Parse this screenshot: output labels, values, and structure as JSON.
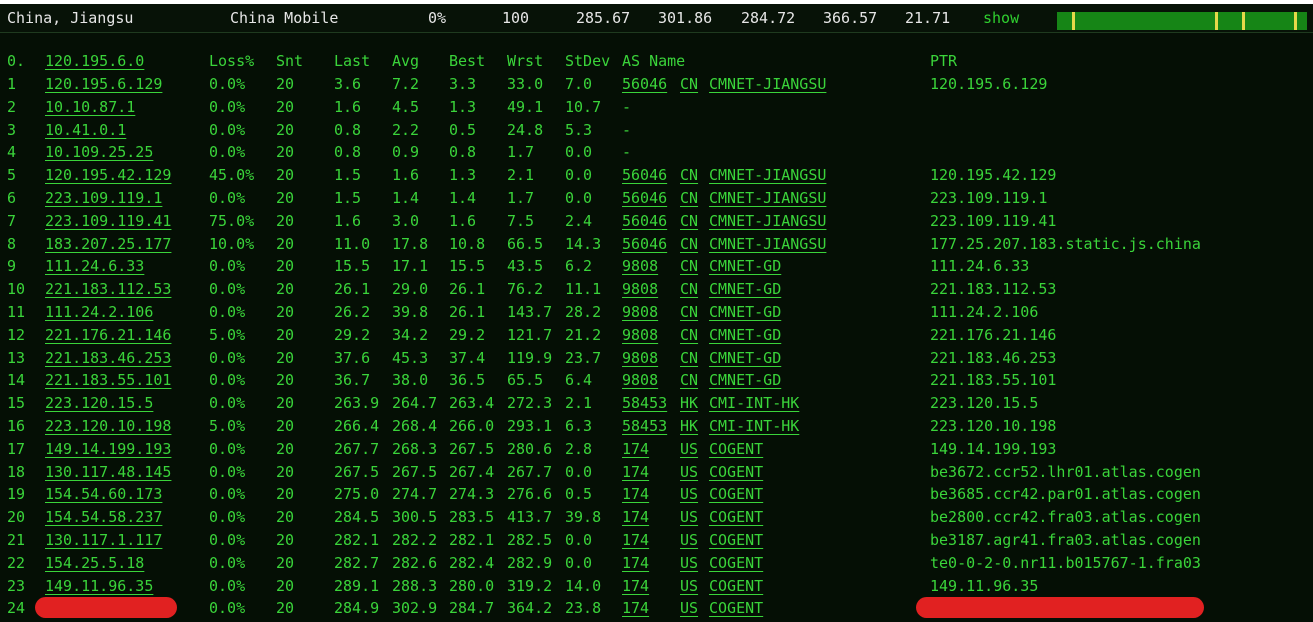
{
  "summary": {
    "location": "China, Jiangsu",
    "isp": "China Mobile",
    "loss": "0%",
    "sent": "100",
    "last": "285.67",
    "avg": "301.86",
    "best": "284.72",
    "worst": "366.57",
    "stdev": "21.71",
    "show_label": "show",
    "sparkline_marks": [
      0.06,
      0.64,
      0.75,
      0.96
    ]
  },
  "table": {
    "headers": {
      "index": "0.",
      "host": "120.195.6.0",
      "loss": "Loss%",
      "snt": "Snt",
      "last": "Last",
      "avg": "Avg",
      "best": "Best",
      "wrst": "Wrst",
      "stdev": "StDev",
      "as_name": "AS Name",
      "ptr": "PTR"
    },
    "rows": [
      {
        "idx": "1",
        "host": "120.195.6.129",
        "loss": "0.0%",
        "snt": "20",
        "last": "3.6",
        "avg": "7.2",
        "best": "3.3",
        "wrst": "33.0",
        "stdev": "7.0",
        "asn": "56046",
        "cc": "CN",
        "asname": "CMNET-JIANGSU",
        "ptr": "120.195.6.129"
      },
      {
        "idx": "2",
        "host": "10.10.87.1",
        "loss": "0.0%",
        "snt": "20",
        "last": "1.6",
        "avg": "4.5",
        "best": "1.3",
        "wrst": "49.1",
        "stdev": "10.7",
        "asn": "-",
        "cc": "",
        "asname": "",
        "ptr": ""
      },
      {
        "idx": "3",
        "host": "10.41.0.1",
        "loss": "0.0%",
        "snt": "20",
        "last": "0.8",
        "avg": "2.2",
        "best": "0.5",
        "wrst": "24.8",
        "stdev": "5.3",
        "asn": "-",
        "cc": "",
        "asname": "",
        "ptr": ""
      },
      {
        "idx": "4",
        "host": "10.109.25.25",
        "loss": "0.0%",
        "snt": "20",
        "last": "0.8",
        "avg": "0.9",
        "best": "0.8",
        "wrst": "1.7",
        "stdev": "0.0",
        "asn": "-",
        "cc": "",
        "asname": "",
        "ptr": ""
      },
      {
        "idx": "5",
        "host": "120.195.42.129",
        "loss": "45.0%",
        "snt": "20",
        "last": "1.5",
        "avg": "1.6",
        "best": "1.3",
        "wrst": "2.1",
        "stdev": "0.0",
        "asn": "56046",
        "cc": "CN",
        "asname": "CMNET-JIANGSU",
        "ptr": "120.195.42.129"
      },
      {
        "idx": "6",
        "host": "223.109.119.1",
        "loss": "0.0%",
        "snt": "20",
        "last": "1.5",
        "avg": "1.4",
        "best": "1.4",
        "wrst": "1.7",
        "stdev": "0.0",
        "asn": "56046",
        "cc": "CN",
        "asname": "CMNET-JIANGSU",
        "ptr": "223.109.119.1"
      },
      {
        "idx": "7",
        "host": "223.109.119.41",
        "loss": "75.0%",
        "snt": "20",
        "last": "1.6",
        "avg": "3.0",
        "best": "1.6",
        "wrst": "7.5",
        "stdev": "2.4",
        "asn": "56046",
        "cc": "CN",
        "asname": "CMNET-JIANGSU",
        "ptr": "223.109.119.41"
      },
      {
        "idx": "8",
        "host": "183.207.25.177",
        "loss": "10.0%",
        "snt": "20",
        "last": "11.0",
        "avg": "17.8",
        "best": "10.8",
        "wrst": "66.5",
        "stdev": "14.3",
        "asn": "56046",
        "cc": "CN",
        "asname": "CMNET-JIANGSU",
        "ptr": "177.25.207.183.static.js.china"
      },
      {
        "idx": "9",
        "host": "111.24.6.33",
        "loss": "0.0%",
        "snt": "20",
        "last": "15.5",
        "avg": "17.1",
        "best": "15.5",
        "wrst": "43.5",
        "stdev": "6.2",
        "asn": "9808",
        "cc": "CN",
        "asname": "CMNET-GD",
        "ptr": "111.24.6.33"
      },
      {
        "idx": "10",
        "host": "221.183.112.53",
        "loss": "0.0%",
        "snt": "20",
        "last": "26.1",
        "avg": "29.0",
        "best": "26.1",
        "wrst": "76.2",
        "stdev": "11.1",
        "asn": "9808",
        "cc": "CN",
        "asname": "CMNET-GD",
        "ptr": "221.183.112.53"
      },
      {
        "idx": "11",
        "host": "111.24.2.106",
        "loss": "0.0%",
        "snt": "20",
        "last": "26.2",
        "avg": "39.8",
        "best": "26.1",
        "wrst": "143.7",
        "stdev": "28.2",
        "asn": "9808",
        "cc": "CN",
        "asname": "CMNET-GD",
        "ptr": "111.24.2.106"
      },
      {
        "idx": "12",
        "host": "221.176.21.146",
        "loss": "5.0%",
        "snt": "20",
        "last": "29.2",
        "avg": "34.2",
        "best": "29.2",
        "wrst": "121.7",
        "stdev": "21.2",
        "asn": "9808",
        "cc": "CN",
        "asname": "CMNET-GD",
        "ptr": "221.176.21.146"
      },
      {
        "idx": "13",
        "host": "221.183.46.253",
        "loss": "0.0%",
        "snt": "20",
        "last": "37.6",
        "avg": "45.3",
        "best": "37.4",
        "wrst": "119.9",
        "stdev": "23.7",
        "asn": "9808",
        "cc": "CN",
        "asname": "CMNET-GD",
        "ptr": "221.183.46.253"
      },
      {
        "idx": "14",
        "host": "221.183.55.101",
        "loss": "0.0%",
        "snt": "20",
        "last": "36.7",
        "avg": "38.0",
        "best": "36.5",
        "wrst": "65.5",
        "stdev": "6.4",
        "asn": "9808",
        "cc": "CN",
        "asname": "CMNET-GD",
        "ptr": "221.183.55.101"
      },
      {
        "idx": "15",
        "host": "223.120.15.5",
        "loss": "0.0%",
        "snt": "20",
        "last": "263.9",
        "avg": "264.7",
        "best": "263.4",
        "wrst": "272.3",
        "stdev": "2.1",
        "asn": "58453",
        "cc": "HK",
        "asname": "CMI-INT-HK",
        "ptr": "223.120.15.5"
      },
      {
        "idx": "16",
        "host": "223.120.10.198",
        "loss": "5.0%",
        "snt": "20",
        "last": "266.4",
        "avg": "268.4",
        "best": "266.0",
        "wrst": "293.1",
        "stdev": "6.3",
        "asn": "58453",
        "cc": "HK",
        "asname": "CMI-INT-HK",
        "ptr": "223.120.10.198"
      },
      {
        "idx": "17",
        "host": "149.14.199.193",
        "loss": "0.0%",
        "snt": "20",
        "last": "267.7",
        "avg": "268.3",
        "best": "267.5",
        "wrst": "280.6",
        "stdev": "2.8",
        "asn": "174",
        "cc": "US",
        "asname": "COGENT",
        "ptr": "149.14.199.193"
      },
      {
        "idx": "18",
        "host": "130.117.48.145",
        "loss": "0.0%",
        "snt": "20",
        "last": "267.5",
        "avg": "267.5",
        "best": "267.4",
        "wrst": "267.7",
        "stdev": "0.0",
        "asn": "174",
        "cc": "US",
        "asname": "COGENT",
        "ptr": "be3672.ccr52.lhr01.atlas.cogen"
      },
      {
        "idx": "19",
        "host": "154.54.60.173",
        "loss": "0.0%",
        "snt": "20",
        "last": "275.0",
        "avg": "274.7",
        "best": "274.3",
        "wrst": "276.6",
        "stdev": "0.5",
        "asn": "174",
        "cc": "US",
        "asname": "COGENT",
        "ptr": "be3685.ccr42.par01.atlas.cogen"
      },
      {
        "idx": "20",
        "host": "154.54.58.237",
        "loss": "0.0%",
        "snt": "20",
        "last": "284.5",
        "avg": "300.5",
        "best": "283.5",
        "wrst": "413.7",
        "stdev": "39.8",
        "asn": "174",
        "cc": "US",
        "asname": "COGENT",
        "ptr": "be2800.ccr42.fra03.atlas.cogen"
      },
      {
        "idx": "21",
        "host": "130.117.1.117",
        "loss": "0.0%",
        "snt": "20",
        "last": "282.1",
        "avg": "282.2",
        "best": "282.1",
        "wrst": "282.5",
        "stdev": "0.0",
        "asn": "174",
        "cc": "US",
        "asname": "COGENT",
        "ptr": "be3187.agr41.fra03.atlas.cogen"
      },
      {
        "idx": "22",
        "host": "154.25.5.18",
        "loss": "0.0%",
        "snt": "20",
        "last": "282.7",
        "avg": "282.6",
        "best": "282.4",
        "wrst": "282.9",
        "stdev": "0.0",
        "asn": "174",
        "cc": "US",
        "asname": "COGENT",
        "ptr": "te0-0-2-0.nr11.b015767-1.fra03"
      },
      {
        "idx": "23",
        "host": "149.11.96.35",
        "loss": "0.0%",
        "snt": "20",
        "last": "289.1",
        "avg": "288.3",
        "best": "280.0",
        "wrst": "319.2",
        "stdev": "14.0",
        "asn": "174",
        "cc": "US",
        "asname": "COGENT",
        "ptr": "149.11.96.35"
      },
      {
        "idx": "24",
        "host": "",
        "loss": "0.0%",
        "snt": "20",
        "last": "284.9",
        "avg": "302.9",
        "best": "284.7",
        "wrst": "364.2",
        "stdev": "23.8",
        "asn": "174",
        "cc": "US",
        "asname": "COGENT",
        "ptr": ""
      }
    ]
  },
  "colors": {
    "text_green": "#3ad43a",
    "background": "#050f05",
    "redaction": "#e12121",
    "sparkline": "#168516",
    "sparkline_mark": "#e4d94a"
  }
}
